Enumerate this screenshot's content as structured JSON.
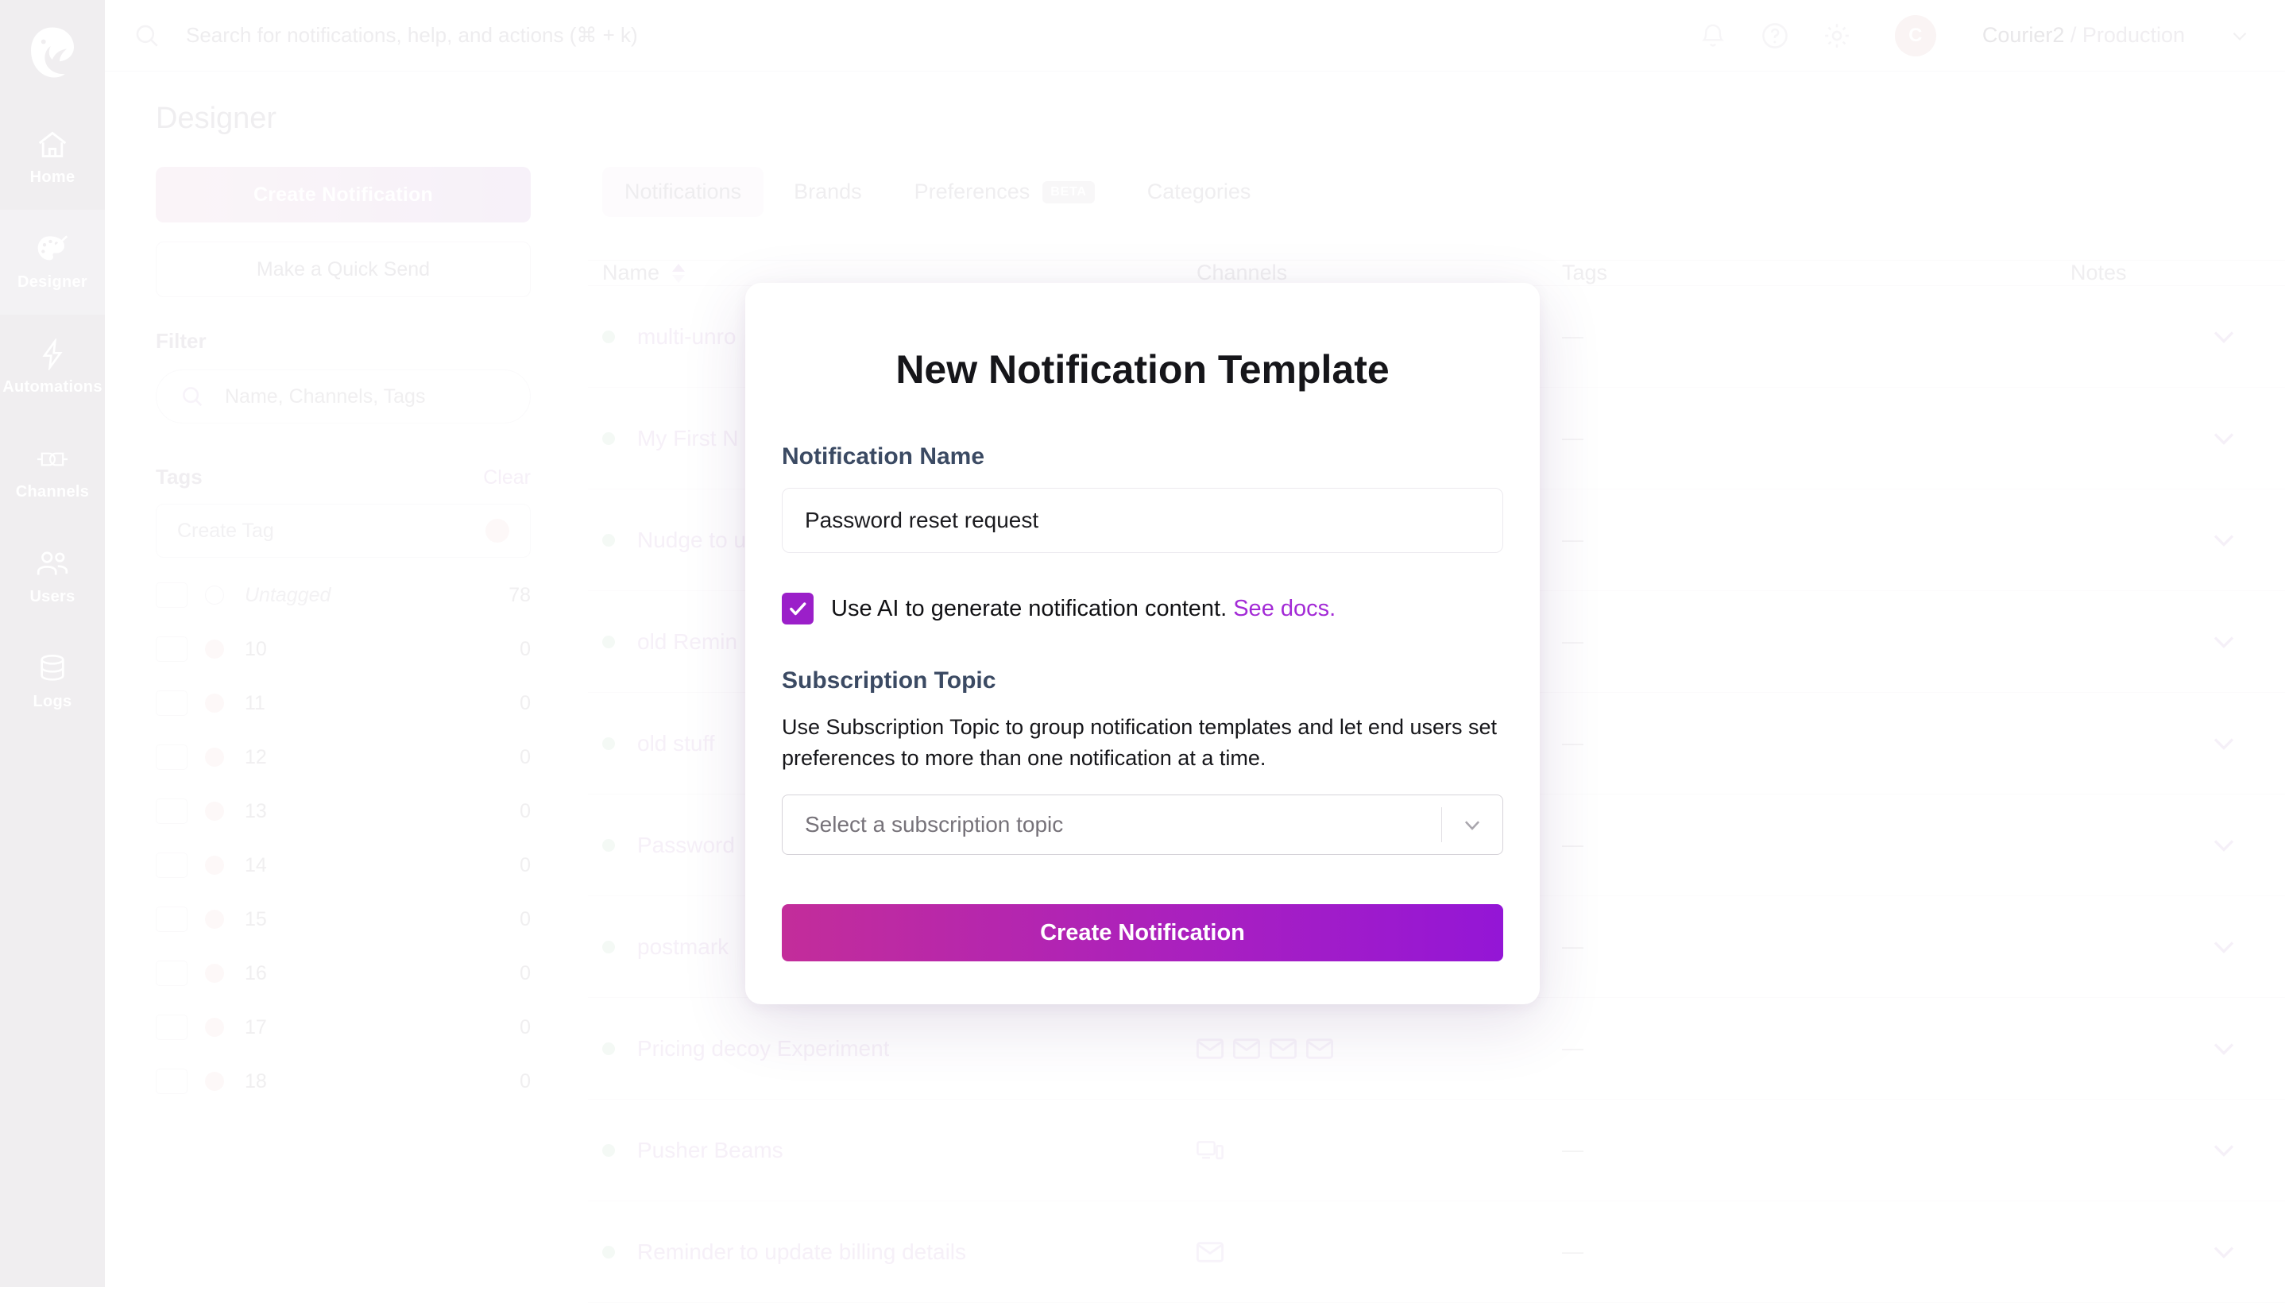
{
  "brand": {
    "logo_icon": "courier-bird-logo"
  },
  "topbar": {
    "search_icon": "search-icon",
    "search_placeholder": "Search for notifications, help, and actions (⌘ + k)",
    "bell_icon": "bell-icon",
    "help_icon": "help-circle-icon",
    "settings_icon": "gear-icon",
    "avatar_initial": "C",
    "account_name": "Courier2 ",
    "account_sep": "/ ",
    "account_env": "Production",
    "account_caret_icon": "chevron-down-icon"
  },
  "rail": {
    "items": [
      {
        "label": "Home",
        "icon": "home-icon",
        "active": false
      },
      {
        "label": "Designer",
        "icon": "palette-icon",
        "active": true
      },
      {
        "label": "Automations",
        "icon": "lightning-icon",
        "active": false
      },
      {
        "label": "Channels",
        "icon": "plug-icon",
        "active": false
      },
      {
        "label": "Users",
        "icon": "users-icon",
        "active": false
      },
      {
        "label": "Logs",
        "icon": "database-icon",
        "active": false
      }
    ]
  },
  "page": {
    "title": "Designer"
  },
  "left_panel": {
    "create_button": "Create Notification",
    "quick_send_button": "Make a Quick Send",
    "filter_heading": "Filter",
    "filter_icon": "search-icon",
    "filter_placeholder": "Name, Channels, Tags",
    "tags_heading": "Tags",
    "clear_link": "Clear",
    "create_tag_placeholder": "Create Tag",
    "tags": [
      {
        "name": "Untagged",
        "count": "78",
        "untagged": true
      },
      {
        "name": "10",
        "count": "0",
        "untagged": false
      },
      {
        "name": "11",
        "count": "0",
        "untagged": false
      },
      {
        "name": "12",
        "count": "0",
        "untagged": false
      },
      {
        "name": "13",
        "count": "0",
        "untagged": false
      },
      {
        "name": "14",
        "count": "0",
        "untagged": false
      },
      {
        "name": "15",
        "count": "0",
        "untagged": false
      },
      {
        "name": "16",
        "count": "0",
        "untagged": false
      },
      {
        "name": "17",
        "count": "0",
        "untagged": false
      },
      {
        "name": "18",
        "count": "0",
        "untagged": false
      }
    ]
  },
  "tabs": [
    {
      "label": "Notifications",
      "active": true,
      "badge": ""
    },
    {
      "label": "Brands",
      "active": false,
      "badge": ""
    },
    {
      "label": "Preferences",
      "active": false,
      "badge": "BETA"
    },
    {
      "label": "Categories",
      "active": false,
      "badge": ""
    }
  ],
  "table": {
    "columns": {
      "name": "Name",
      "channels": "Channels",
      "tags": "Tags",
      "notes": "Notes"
    },
    "sort_icon": "sort-arrows-icon",
    "rows": [
      {
        "name": "multi-unro",
        "channels": [],
        "tags": "—",
        "notes": ""
      },
      {
        "name": "My First N",
        "channels": [],
        "tags": "—",
        "notes": ""
      },
      {
        "name": "Nudge to u",
        "channels": [],
        "tags": "—",
        "notes": ""
      },
      {
        "name": "old Remin",
        "channels": [],
        "tags": "—",
        "notes": ""
      },
      {
        "name": "old stuff",
        "channels": [],
        "tags": "—",
        "notes": ""
      },
      {
        "name": "Password",
        "channels": [],
        "tags": "—",
        "notes": ""
      },
      {
        "name": "postmark",
        "channels": [],
        "tags": "—",
        "notes": ""
      },
      {
        "name": "Pricing decoy Experiment",
        "channels": [
          "email",
          "email",
          "email",
          "email"
        ],
        "tags": "—",
        "notes": ""
      },
      {
        "name": "Pusher Beams",
        "channels": [
          "push"
        ],
        "tags": "—",
        "notes": ""
      },
      {
        "name": "Reminder to update billing details",
        "channels": [
          "email"
        ],
        "tags": "—",
        "notes": ""
      }
    ]
  },
  "modal": {
    "title": "New Notification Template",
    "name_label": "Notification Name",
    "name_value": "Password reset request",
    "ai_checkbox_checked": true,
    "ai_text": "Use AI to generate notification content. ",
    "ai_link": "See docs.",
    "subscription_label": "Subscription Topic",
    "subscription_desc": "Use Subscription Topic to group notification templates and let end users set preferences to more than one notification at a time.",
    "select_placeholder": "Select a subscription topic",
    "select_caret_icon": "chevron-down-icon",
    "submit_label": "Create Notification"
  },
  "colors": {
    "accent_purple": "#9b1fc9",
    "accent_magenta": "#c32d9a",
    "link_purple": "#a32ad6",
    "rail_bg": "#cfc9d2",
    "status_green": "#d6f0dd"
  }
}
